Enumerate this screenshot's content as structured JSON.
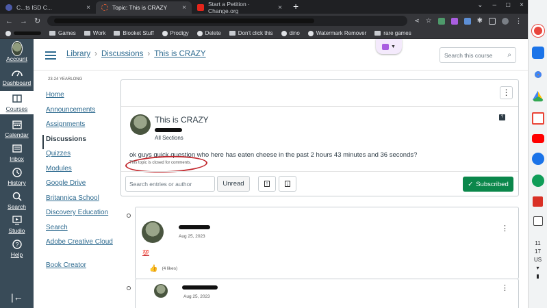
{
  "browser": {
    "tabs": [
      {
        "label": "C...ts ISD C...",
        "active": false,
        "favicon_color": "#4c5aa8"
      },
      {
        "label": "Topic: This is CRAZY",
        "active": true,
        "favicon_color": "#e66135"
      },
      {
        "label": "Start a Petition · Change.org",
        "active": false,
        "favicon_color": "#e4251b"
      }
    ],
    "new_tab": "+",
    "bookmarks": [
      {
        "label": "Games",
        "icon": "folder-icon"
      },
      {
        "label": "Work",
        "icon": "folder-icon"
      },
      {
        "label": "Blooket Stuff",
        "icon": "folder-icon"
      },
      {
        "label": "Prodigy",
        "icon": "globe-icon"
      },
      {
        "label": "Delete",
        "icon": "globe-icon"
      },
      {
        "label": "Don't click this",
        "icon": "folder-icon"
      },
      {
        "label": "dino",
        "icon": "globe-icon"
      },
      {
        "label": "Watermark Remover",
        "icon": "globe-icon"
      },
      {
        "label": "rare games",
        "icon": "folder-icon"
      }
    ]
  },
  "shelf": {
    "time_hour": "11",
    "time_min": "17",
    "locale": "US"
  },
  "global_nav": [
    {
      "label": "Account",
      "icon": "account-avatar-icon",
      "active": false
    },
    {
      "label": "Dashboard",
      "icon": "dashboard-icon",
      "active": false
    },
    {
      "label": "Courses",
      "icon": "courses-icon",
      "active": true
    },
    {
      "label": "Calendar",
      "icon": "calendar-icon",
      "active": false
    },
    {
      "label": "Inbox",
      "icon": "inbox-icon",
      "active": false
    },
    {
      "label": "History",
      "icon": "history-icon",
      "active": false
    },
    {
      "label": "Search",
      "icon": "search-icon",
      "active": false
    },
    {
      "label": "Studio",
      "icon": "studio-icon",
      "active": false
    },
    {
      "label": "Help",
      "icon": "help-icon",
      "active": false
    }
  ],
  "header": {
    "breadcrumbs": [
      "Library",
      "Discussions",
      "This is CRAZY"
    ],
    "search_placeholder": "Search this course"
  },
  "course_nav": {
    "term": "23-24 YEARLONG",
    "items": [
      "Home",
      "Announcements",
      "Assignments",
      "Discussions",
      "Quizzes",
      "Modules",
      "Google Drive",
      "Britannica School",
      "Discovery Education",
      "Search",
      "Adobe Creative Cloud",
      "Book Creator"
    ],
    "active": "Discussions"
  },
  "topic": {
    "title": "This is CRAZY",
    "sections": "All Sections",
    "message": "ok guys quick question who here has eaten cheese in the past 2 hours 43 minutes and 36 seconds?",
    "closed_note": "This topic is closed for comments.",
    "badge": "?"
  },
  "filter": {
    "search_placeholder": "Search entries or author",
    "unread_label": "Unread",
    "subscribed_label": "Subscribed"
  },
  "replies": [
    {
      "date": "Aug 25, 2023",
      "content": "💯",
      "likes": "(4 likes)"
    },
    {
      "date": "Aug 25, 2023"
    }
  ],
  "colors": {
    "canvas_nav": "#394b58",
    "link": "#2d6a8f",
    "subscribed_green": "#0b874b",
    "annotation_red": "#c1272d"
  }
}
